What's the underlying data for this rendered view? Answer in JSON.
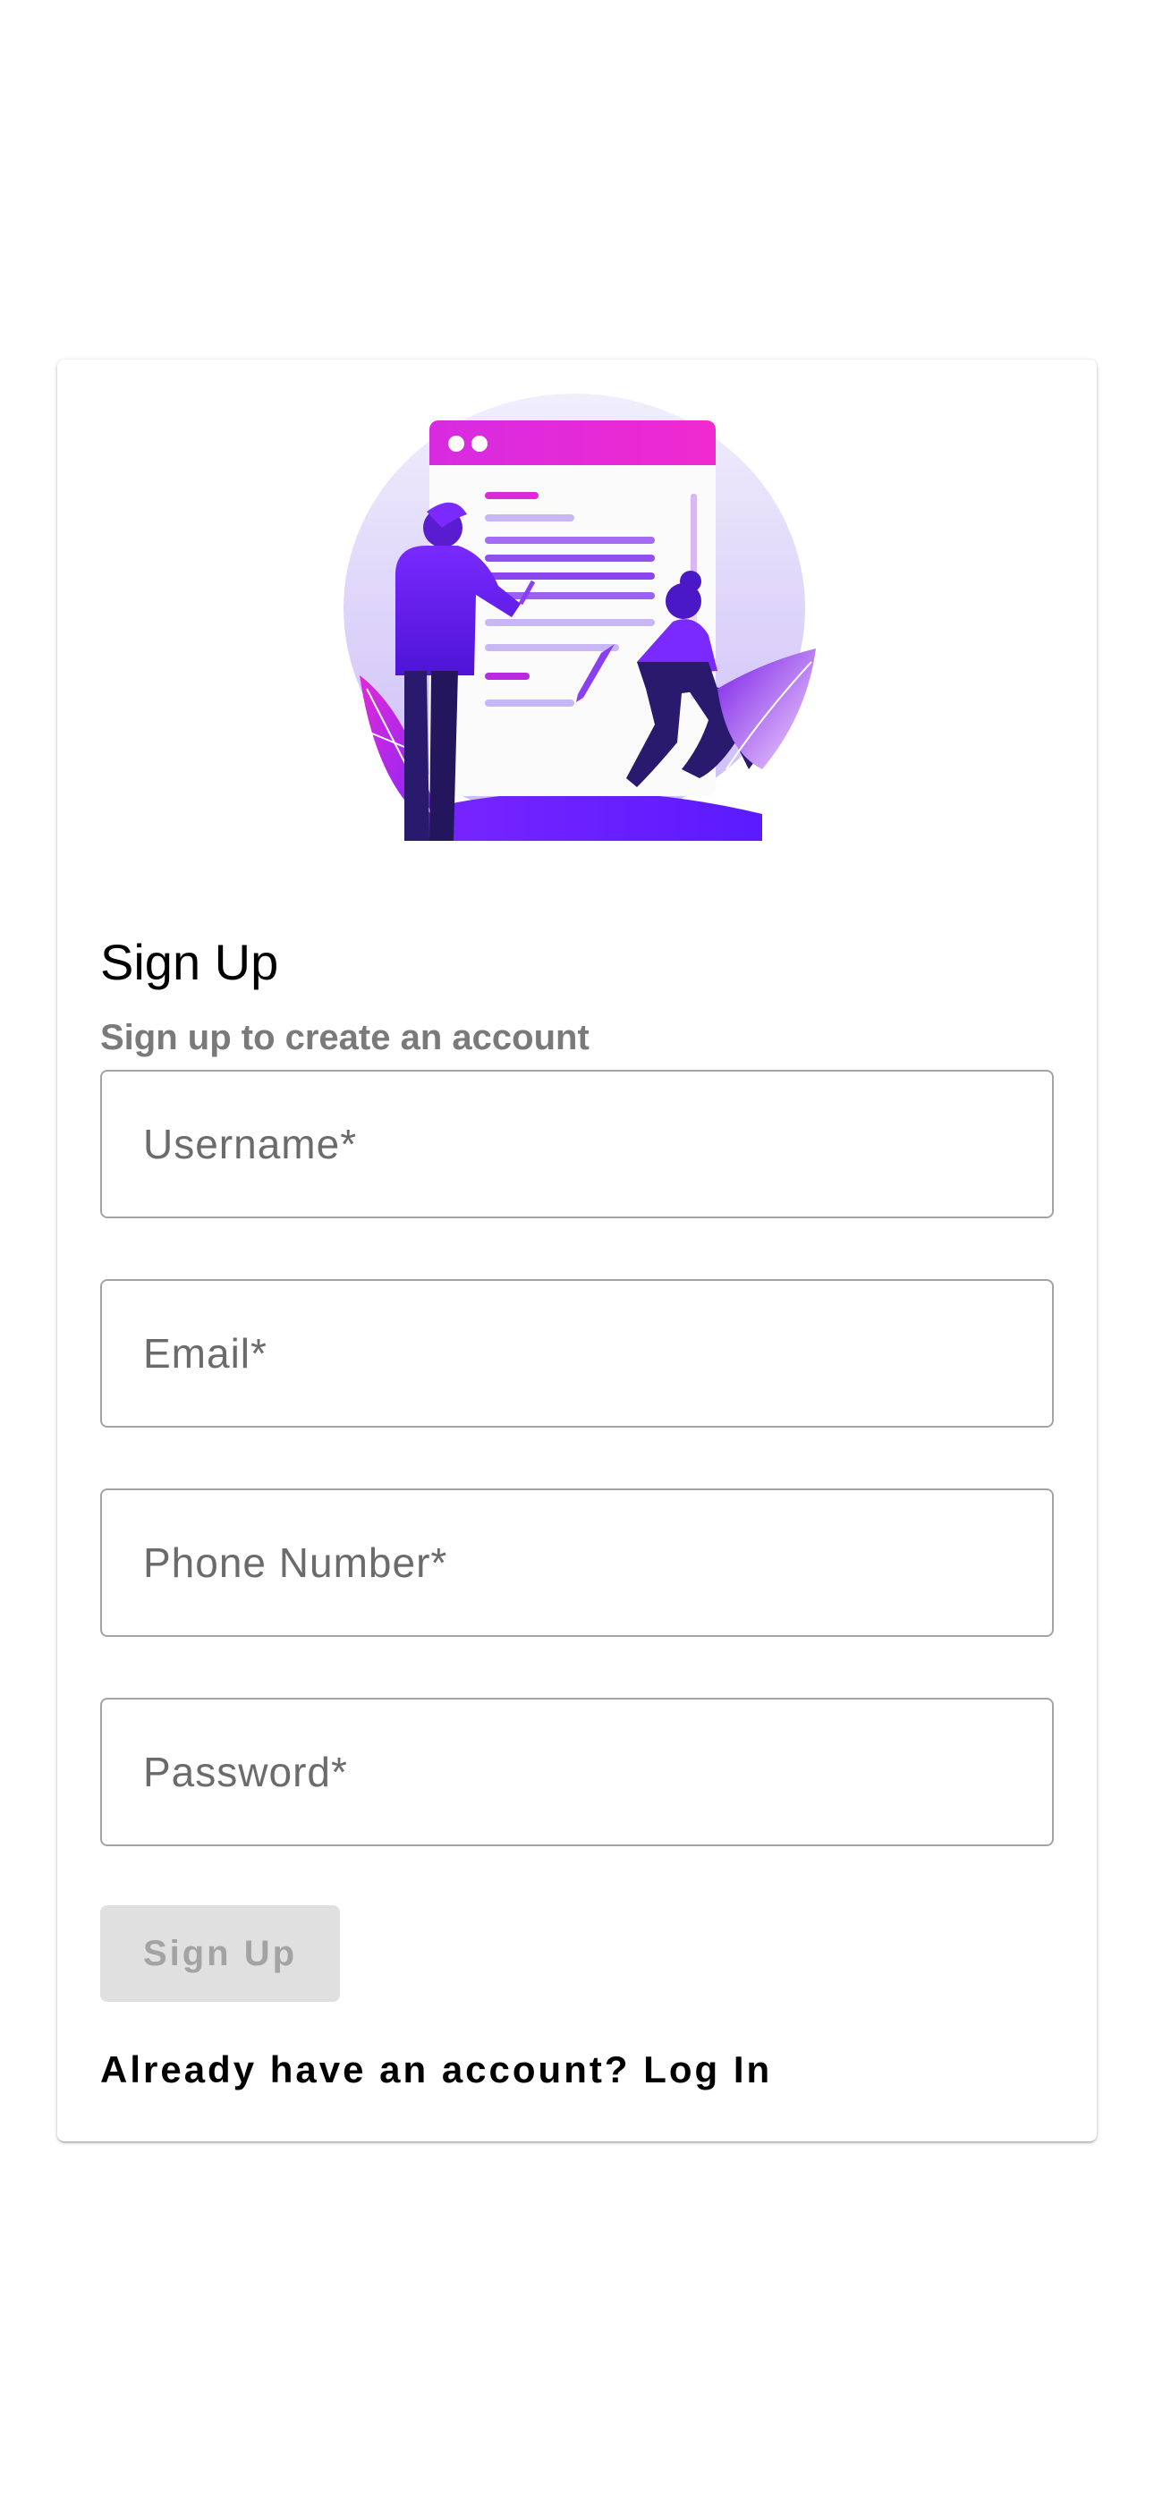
{
  "form": {
    "title": "Sign Up",
    "subtitle": "Sign up to create an account",
    "fields": [
      {
        "placeholder": "Username*"
      },
      {
        "placeholder": "Email*"
      },
      {
        "placeholder": "Phone Number*"
      },
      {
        "placeholder": "Password*"
      }
    ],
    "submit_label": "Sign Up",
    "login_prompt": "Already have an account?",
    "login_link": "Log In"
  },
  "colors": {
    "accent_purple": "#6a1bff",
    "accent_magenta": "#e62bd8",
    "button_disabled_bg": "#e0e0e0",
    "button_disabled_text": "#a3a3a3",
    "field_border": "#a3a3a3"
  },
  "icons": {
    "hero": "signup-illustration"
  }
}
